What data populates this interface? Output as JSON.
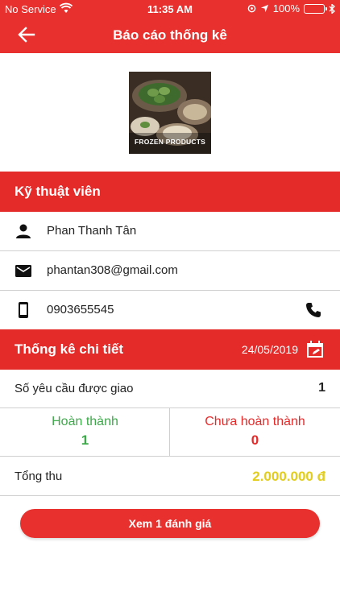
{
  "status_bar": {
    "carrier": "No Service",
    "time": "11:35 AM",
    "battery": "100%"
  },
  "header": {
    "title": "Báo cáo thống kê"
  },
  "logo": {
    "caption": "FROZEN PRODUCTS"
  },
  "technician": {
    "section_title": "Kỹ thuật viên",
    "name": "Phan Thanh Tân",
    "email": "phantan308@gmail.com",
    "phone": "0903655545"
  },
  "details": {
    "section_title": "Thống kê chi tiết",
    "date": "24/05/2019",
    "assigned_label": "Số yêu cầu được giao",
    "assigned_value": "1",
    "completed_label": "Hoàn thành",
    "completed_value": "1",
    "incomplete_label": "Chưa hoàn thành",
    "incomplete_value": "0",
    "revenue_label": "Tổng thu",
    "revenue_value": "2.000.000 đ"
  },
  "actions": {
    "reviews_button": "Xem 1 đánh giá"
  },
  "colors": {
    "primary": "#e8312f",
    "success": "#3ea94a",
    "revenue": "#e2cd1c"
  },
  "icons": [
    "back-arrow-icon",
    "person-icon",
    "mail-icon",
    "smartphone-icon",
    "phone-call-icon",
    "calendar-edit-icon",
    "wifi-icon",
    "location-icon",
    "bluetooth-icon",
    "battery-icon"
  ]
}
